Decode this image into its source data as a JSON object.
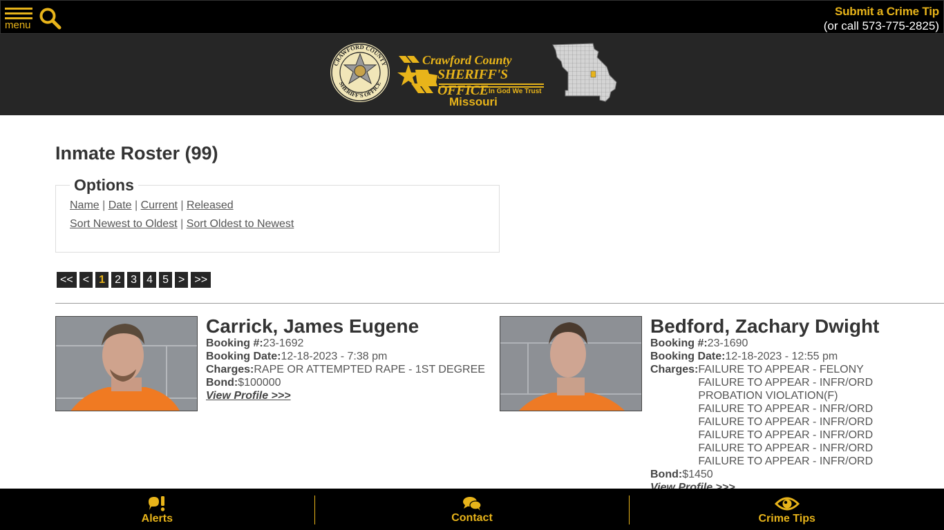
{
  "topbar": {
    "menu_label": "menu",
    "menu_icon": "hamburger-menu-icon",
    "search_icon": "search-icon",
    "tip_title": "Submit a Crime Tip",
    "tip_phone": "(or call 573-775-2825)"
  },
  "banner": {
    "seal_text_top": "CRAWFORD COUNTY",
    "seal_text_bottom": "SHERIFF'S OFFICE",
    "logo_line1": "Crawford County",
    "logo_line2": "SHERIFF'S OFFICE",
    "motto": "In God We Trust",
    "state": "Missouri"
  },
  "page": {
    "title": "Inmate Roster (99)",
    "options_legend": "Options",
    "filter_links": [
      "Name",
      "Date",
      "Current",
      "Released"
    ],
    "sort_links": [
      "Sort Newest to Oldest",
      "Sort Oldest to Newest"
    ],
    "separator": "|"
  },
  "pagination": {
    "first": "<<",
    "prev": "<",
    "pages": [
      "1",
      "2",
      "3",
      "4",
      "5"
    ],
    "current": "1",
    "next": ">",
    "last": ">>"
  },
  "labels": {
    "booking_no": "Booking #:",
    "booking_date": "Booking Date:",
    "charges": "Charges:",
    "bond": "Bond:",
    "view_profile": "View Profile >>>"
  },
  "inmates": [
    {
      "name": "Carrick, James Eugene",
      "booking_no": "23-1692",
      "booking_date": "12-18-2023 - 7:38 pm",
      "charges": [
        "RAPE OR ATTEMPTED RAPE - 1ST DEGREE"
      ],
      "bond": "$100000"
    },
    {
      "name": "Bedford, Zachary Dwight",
      "booking_no": "23-1690",
      "booking_date": "12-18-2023 - 12:55 pm",
      "charges": [
        "FAILURE TO APPEAR - FELONY",
        "FAILURE TO APPEAR - INFR/ORD",
        "PROBATION VIOLATION(F)",
        "FAILURE TO APPEAR - INFR/ORD",
        "FAILURE TO APPEAR - INFR/ORD",
        "FAILURE TO APPEAR - INFR/ORD",
        "FAILURE TO APPEAR - INFR/ORD",
        "FAILURE TO APPEAR - INFR/ORD"
      ],
      "bond": "$1450"
    }
  ],
  "bottom_nav": [
    {
      "label": "Alerts",
      "icon": "alert-bubble-icon"
    },
    {
      "label": "Contact",
      "icon": "chat-bubbles-icon"
    },
    {
      "label": "Crime Tips",
      "icon": "eye-icon"
    }
  ],
  "colors": {
    "accent": "#e8b41a",
    "topbar_bg": "#000000",
    "banner_bg": "#262626",
    "pager_bg": "#262626"
  }
}
